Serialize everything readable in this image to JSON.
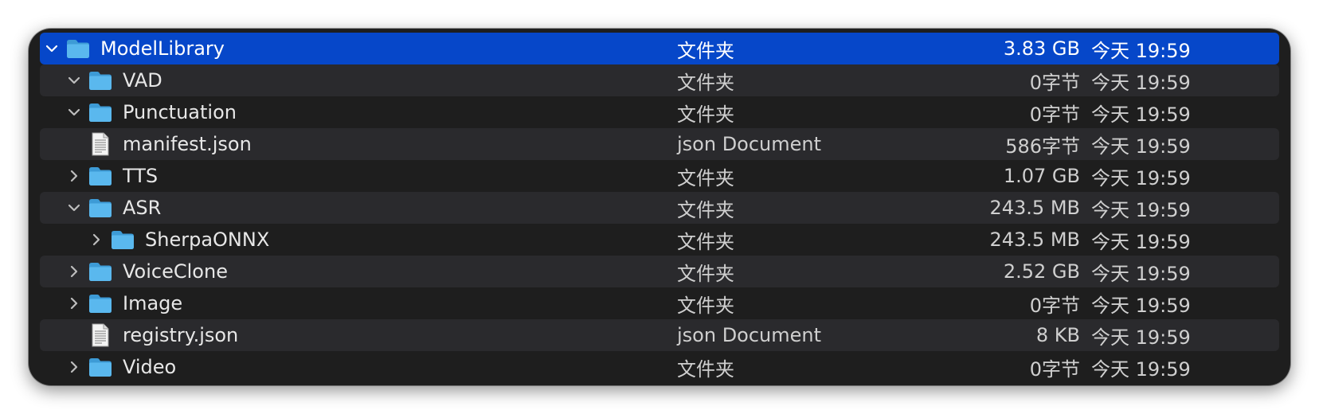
{
  "colors": {
    "window_bg": "#1e1e1e",
    "alt_row_bg": "#2a2a2d",
    "selected_row_bg": "#0647c9",
    "folder_blue": "#5ab8ee",
    "text": "#e7e7e7"
  },
  "rows": [
    {
      "name": "ModelLibrary",
      "kind": "文件夹",
      "size": "3.83 GB",
      "date": "今天 19:59",
      "icon": "folder-icon",
      "disclosure": "expanded",
      "level": 0,
      "selected": true
    },
    {
      "name": "VAD",
      "kind": "文件夹",
      "size": "0字节",
      "date": "今天 19:59",
      "icon": "folder-icon",
      "disclosure": "expanded",
      "level": 1
    },
    {
      "name": "Punctuation",
      "kind": "文件夹",
      "size": "0字节",
      "date": "今天 19:59",
      "icon": "folder-icon",
      "disclosure": "expanded",
      "level": 1
    },
    {
      "name": "manifest.json",
      "kind": "json Document",
      "size": "586字节",
      "date": "今天 19:59",
      "icon": "document-icon",
      "disclosure": "none",
      "level": 1
    },
    {
      "name": "TTS",
      "kind": "文件夹",
      "size": "1.07 GB",
      "date": "今天 19:59",
      "icon": "folder-icon",
      "disclosure": "collapsed",
      "level": 1
    },
    {
      "name": "ASR",
      "kind": "文件夹",
      "size": "243.5 MB",
      "date": "今天 19:59",
      "icon": "folder-icon",
      "disclosure": "expanded",
      "level": 1
    },
    {
      "name": "SherpaONNX",
      "kind": "文件夹",
      "size": "243.5 MB",
      "date": "今天 19:59",
      "icon": "folder-icon",
      "disclosure": "collapsed",
      "level": 2
    },
    {
      "name": "VoiceClone",
      "kind": "文件夹",
      "size": "2.52 GB",
      "date": "今天 19:59",
      "icon": "folder-icon",
      "disclosure": "collapsed",
      "level": 1
    },
    {
      "name": "Image",
      "kind": "文件夹",
      "size": "0字节",
      "date": "今天 19:59",
      "icon": "folder-icon",
      "disclosure": "collapsed",
      "level": 1
    },
    {
      "name": "registry.json",
      "kind": "json Document",
      "size": "8 KB",
      "date": "今天 19:59",
      "icon": "document-icon",
      "disclosure": "none",
      "level": 1
    },
    {
      "name": "Video",
      "kind": "文件夹",
      "size": "0字节",
      "date": "今天 19:59",
      "icon": "folder-icon",
      "disclosure": "collapsed",
      "level": 1
    }
  ]
}
